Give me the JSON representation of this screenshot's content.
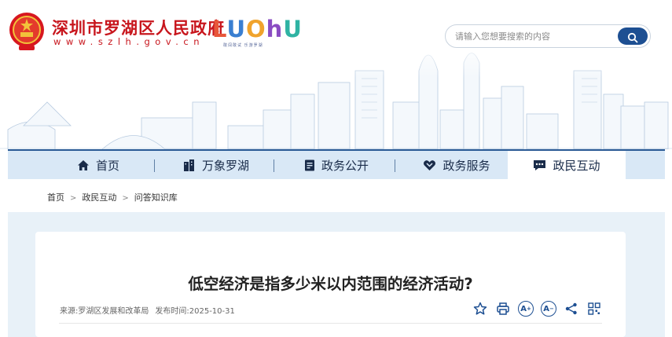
{
  "header": {
    "site_title": "深圳市罗湖区人民政府",
    "site_url": "www.szlh.gov.cn",
    "logo_text": "LUOhU",
    "logo_letters": [
      {
        "char": "L",
        "color": "#e8573a"
      },
      {
        "char": "U",
        "color": "#3a7fd1"
      },
      {
        "char": "O",
        "color": "#f0a32c"
      },
      {
        "char": "h",
        "color": "#8a4cc2"
      },
      {
        "char": "U",
        "color": "#2fb3a3"
      }
    ],
    "logo_sub": "敢闯敢试 乐游罗湖"
  },
  "search": {
    "placeholder": "请输入您想要搜索的内容",
    "button_icon": "search-icon"
  },
  "nav": {
    "items": [
      {
        "label": "首页",
        "icon": "home-icon"
      },
      {
        "label": "万象罗湖",
        "icon": "buildings-icon"
      },
      {
        "label": "政务公开",
        "icon": "document-icon"
      },
      {
        "label": "政务服务",
        "icon": "service-icon"
      },
      {
        "label": "政民互动",
        "icon": "chat-icon",
        "active": true
      }
    ]
  },
  "breadcrumb": {
    "items": [
      "首页",
      "政民互动",
      "问答知识库"
    ],
    "separator": ">"
  },
  "article": {
    "title": "低空经济是指多少米以内范围的经济活动?",
    "source_label": "来源:",
    "source": "罗湖区发展和改革局",
    "date_label": "发布时间:",
    "date": "2025-10-31"
  },
  "tools": {
    "font_increase": "A",
    "font_decrease": "A"
  },
  "colors": {
    "brand_red": "#c8161d",
    "nav_bg": "#d9e8f6",
    "accent_blue": "#1d4f92",
    "content_bg": "#e8f1f8"
  }
}
